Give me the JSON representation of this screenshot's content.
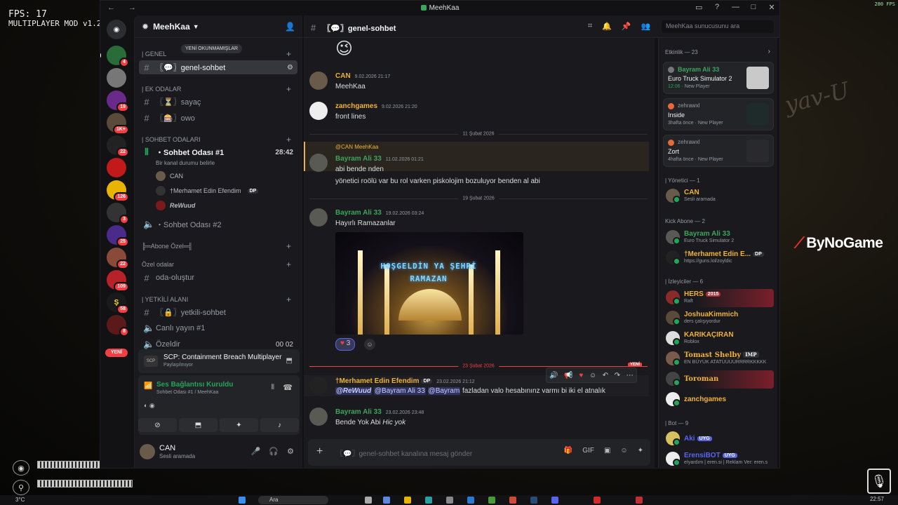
{
  "overlay": {
    "fps": "FPS: 17",
    "mod": "MULTIPLAYER MOD v1.2.",
    "fps_corner": "280 FPS",
    "brand": "ByNoGame",
    "temp": "3°C",
    "search": "Ara",
    "clock": "22:57"
  },
  "window": {
    "title": "MeehKaa",
    "nav": "← →",
    "new_label": "YENİ"
  },
  "servers": [
    {
      "badge": "4"
    },
    {
      "badge": ""
    },
    {
      "badge": "19"
    },
    {
      "badge": "1K+"
    },
    {
      "badge": "22"
    },
    {
      "badge": ""
    },
    {
      "badge": "126"
    },
    {
      "badge": "3"
    },
    {
      "badge": "25"
    },
    {
      "badge": "22"
    },
    {
      "badge": "109"
    },
    {
      "badge": "58"
    },
    {
      "badge": "8"
    }
  ],
  "guild": {
    "name": "MeehKaa",
    "unread_pill": "YENİ OKUNMAMIŞLAR"
  },
  "categories": {
    "genel": "| GENEL",
    "ek": "| EK ODALAR",
    "sohbet": "| SOHBET ODALARI",
    "abone": "╠═Abone Özel═╣",
    "ozel": "Özel odalar",
    "yetkili": "| YETKİLİ ALANI"
  },
  "channels": {
    "genel_sohbet": "〖💬〗genel-sohbet",
    "sayac": "〖⏳〗sayaç",
    "owo": "〖🎰〗owo",
    "sohbet1": "・Sohbet Odası #1",
    "sohbet1_time": "28:42",
    "sohbet1_status": "Bir kanal durumu belirle",
    "sohbet2": "・Sohbet Odası #2",
    "oda_olustur": "oda-oluştur",
    "yetkili_sohbet": "〖🔒〗yetkili-sohbet",
    "canli": "Canlı yayın #1",
    "ozeldir": "Özeldir",
    "ozeldir_a": "00",
    "ozeldir_b": "02"
  },
  "voice_users": [
    "CAN",
    "†Merhamet Edin Efendim",
    "ReWuud"
  ],
  "voice_tag_dp": "DP",
  "activity": {
    "title": "SCP: Containment Breach Multiplayer",
    "sub": "Paylaşılmıyor"
  },
  "voice_conn": {
    "title": "Ses Bağlantısı Kuruldu",
    "sub": "Sohbet Odası #1 / MeehKaa"
  },
  "user": {
    "name": "CAN",
    "status": "Sesli aramada"
  },
  "header": {
    "channel": "〖💬〗genel-sohbet",
    "search_placeholder": "MeehKaa sunucusunu ara"
  },
  "messages": {
    "emoji": "😉",
    "m1_user": "CAN",
    "m1_time": "9.02.2026 21:17",
    "m1_text": "MeehKaa",
    "m2_user": "zanchgames",
    "m2_time": "9.02.2026 21:20",
    "m2_text": "front lines",
    "div1": "11 Şubat 2026",
    "m3_reply": "@CAN MeehKaa",
    "m3_user": "Bayram Ali 33",
    "m3_time": "11.02.2026 01:21",
    "m3_text": "abi bende nden",
    "m3_text2": "yönetici roölü var bu rol varken piskolojim bozuluyor benden al abi",
    "div2": "19 Şubat 2026",
    "m4_user": "Bayram Ali 33",
    "m4_time": "19.02.2026 03:24",
    "m4_text": "Hayırlı Ramazanlar",
    "mahya": "HOŞGELDİN YA ŞEHRİ RAMAZAN",
    "reaction_count": "3",
    "div3": "23 Şubat 2026",
    "new_badge": "YENİ",
    "m5_user": "†Merhamet Edin Efendim",
    "m5_tag": "DP",
    "m5_time": "23.02.2026 21:12",
    "m5_mention1": "@ReWuud",
    "m5_mention2": "@Bayram Ali 33",
    "m5_mention3": "@Bayram",
    "m5_text": "fazladan valo hesabınınz varmı bi iki el atnalık",
    "m6_user": "Bayram Ali 33",
    "m6_time": "23.02.2026 23:48",
    "m6_text": "Bende Yok Abi ",
    "m6_italic": "Hic yok"
  },
  "composer": {
    "placeholder": "〖💬〗genel-sohbet kanalına mesaj gönder"
  },
  "members": {
    "activity_header": "Etkinlik — 23",
    "cards": [
      {
        "user": "Bayram Ali 33",
        "game": "Euro Truck Simulator 2",
        "time": "12:06",
        "meta": "New Player"
      },
      {
        "user": "zehrawxl",
        "game": "Inside",
        "time": "3hafta önce",
        "meta": "New Player"
      },
      {
        "user": "zehrawxl",
        "game": "Zort",
        "time": "4hafta önce",
        "meta": "New Player"
      }
    ],
    "yonetici_header": "| Yönetici — 1",
    "yonetici": [
      {
        "name": "CAN",
        "sub": "Sesli aramada",
        "color": "#f0b232"
      }
    ],
    "kick_header": "Kick Abone — 2",
    "kick": [
      {
        "name": "Bayram Ali 33",
        "sub": "Euro Truck Simulator 2",
        "color": "#3ba55c",
        "tag": ""
      },
      {
        "name": "†Merhamet Edin E...",
        "sub": "https://guns.lol/zoyldic",
        "color": "#f0b232",
        "tag": "DP"
      }
    ],
    "izleyici_header": "| İzleyiciler — 6",
    "izleyici": [
      {
        "name": "HERS",
        "sub": "Raft",
        "color": "#f0b232",
        "tag": "2015"
      },
      {
        "name": "JoshuaKimmich",
        "sub": "ders çalışıyordur",
        "color": "#f0b232",
        "tag": ""
      },
      {
        "name": "KARIKAÇIRAN",
        "sub": "Roblox",
        "color": "#f0b232",
        "tag": ""
      },
      {
        "name": "Tomast Shelby",
        "sub": "EN BÜYÜK ATATÜÜÜÜRRRRKKKKK",
        "color": "#f0b232",
        "tag": "IMP"
      },
      {
        "name": "Toroman",
        "sub": "",
        "color": "#f0b232",
        "tag": ""
      },
      {
        "name": "zanchgames",
        "sub": "",
        "color": "#f0b232",
        "tag": ""
      }
    ],
    "bot_header": "| Bot — 9",
    "bots": [
      {
        "name": "Aki",
        "sub": "",
        "color": "#5865f2",
        "tag": "UYG"
      },
      {
        "name": "ErensiBOT",
        "sub": "eİyardım | eren.si | Reklam Ver: eren.s",
        "color": "#5865f2",
        "tag": "UYG"
      }
    ]
  },
  "colors": {
    "accent": "#5865f2",
    "online": "#23a55a",
    "mention_name": "#f0b232",
    "green_user": "#3ba55c",
    "danger": "#f23f43"
  }
}
